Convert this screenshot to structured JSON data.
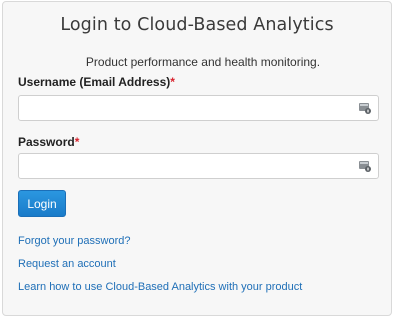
{
  "form": {
    "title": "Login to Cloud-Based Analytics",
    "subtitle": "Product performance and health monitoring.",
    "username": {
      "label": "Username (Email Address)",
      "required_mark": "*",
      "value": "",
      "placeholder": ""
    },
    "password": {
      "label": "Password",
      "required_mark": "*",
      "value": "",
      "placeholder": ""
    },
    "login_button": "Login",
    "links": {
      "forgot_password": "Forgot your password?",
      "request_account": "Request an account",
      "learn_how": "Learn how to use Cloud-Based Analytics with your product"
    },
    "field_icon": "password-manager-card-icon"
  },
  "colors": {
    "accent": "#1f83d1",
    "link": "#1f6fb7",
    "required": "#d9232e"
  }
}
